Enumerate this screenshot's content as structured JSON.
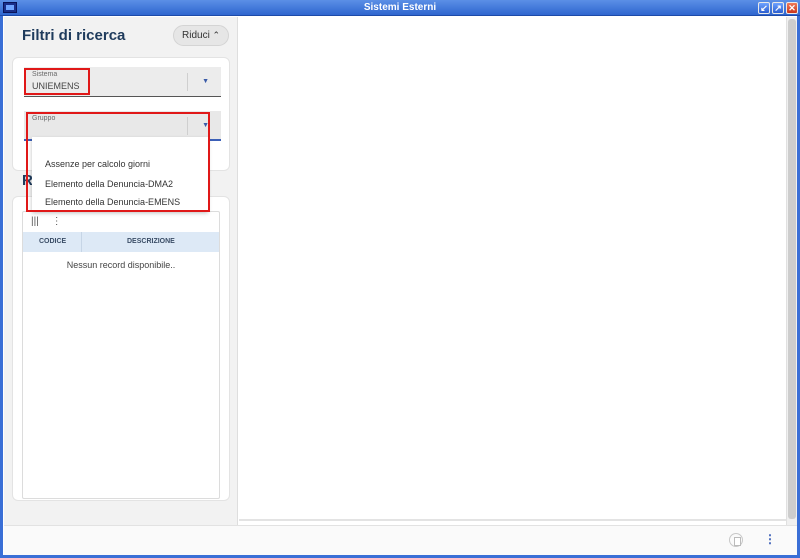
{
  "window": {
    "title": "Sistemi Esterni"
  },
  "filters": {
    "title": "Filtri di ricerca",
    "collapse_label": "Riduci",
    "sistema": {
      "label": "Sistema",
      "value": "UNIEMENS"
    },
    "gruppo": {
      "label": "Gruppo",
      "value": ""
    },
    "gruppo_options": [
      "Assenze per calcolo giorni",
      "Elemento della Denuncia-DMA2",
      "Elemento della Denuncia-EMENS"
    ]
  },
  "results": {
    "title": "R",
    "columns": [
      "CODICE",
      "DESCRIZIONE"
    ],
    "empty_message": "Nessun record disponibile.."
  },
  "icons": {
    "columns": "columns-icon",
    "more": "more-vert-icon",
    "document": "document-icon",
    "menu": "more-vert-icon"
  },
  "colors": {
    "title_bar": "#2f66cf",
    "accent": "#3b5fb7",
    "highlight": "#e01818"
  }
}
